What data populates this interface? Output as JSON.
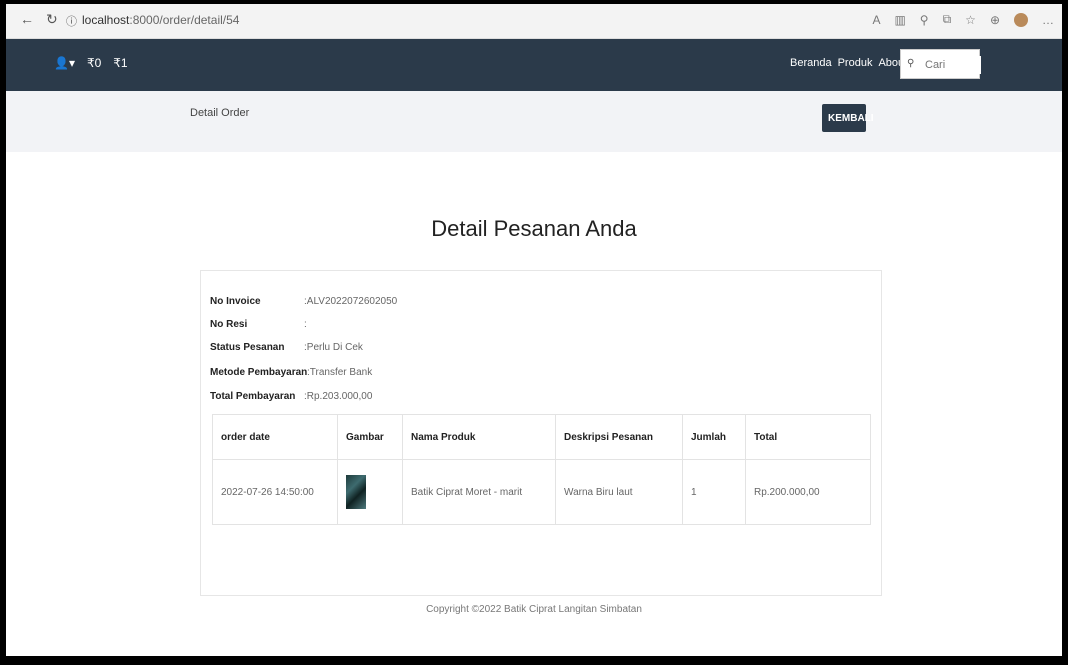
{
  "browser": {
    "url_host": "localhost",
    "url_rest": ":8000/order/detail/54"
  },
  "navbar": {
    "user_icon": "user-icon",
    "cart_count": "0",
    "cart_label": "₹0",
    "order_count": "₹1",
    "links": [
      "Beranda",
      "Produk",
      "About Us"
    ],
    "search_placeholder": "Cari"
  },
  "subbar": {
    "breadcrumb": "Detail Order",
    "back_button": "KEMBALI"
  },
  "page": {
    "title": "Detail Pesanan Anda"
  },
  "order": {
    "fields": [
      {
        "label": "No Invoice",
        "value": ":ALV2022072602050"
      },
      {
        "label": "No Resi",
        "value": ":"
      },
      {
        "label": "Status Pesanan",
        "value": ":Perlu Di Cek"
      },
      {
        "label": "Metode Pembayaran",
        "value": ":Transfer Bank"
      },
      {
        "label": "Total Pembayaran",
        "value": ":Rp.203.000,00"
      }
    ],
    "table": {
      "headers": [
        "order date",
        "Gambar",
        "Nama Produk",
        "Deskripsi Pesanan",
        "Jumlah",
        "Total"
      ],
      "rows": [
        {
          "order_date": "2022-07-26 14:50:00",
          "image": "product-thumbnail",
          "product_name": "Batik Ciprat Moret - marit",
          "description": "Warna Biru laut",
          "quantity": "1",
          "total": "Rp.200.000,00"
        }
      ]
    }
  },
  "footer": {
    "copyright": "Copyright ©2022 Batik Ciprat Langitan Simbatan"
  }
}
